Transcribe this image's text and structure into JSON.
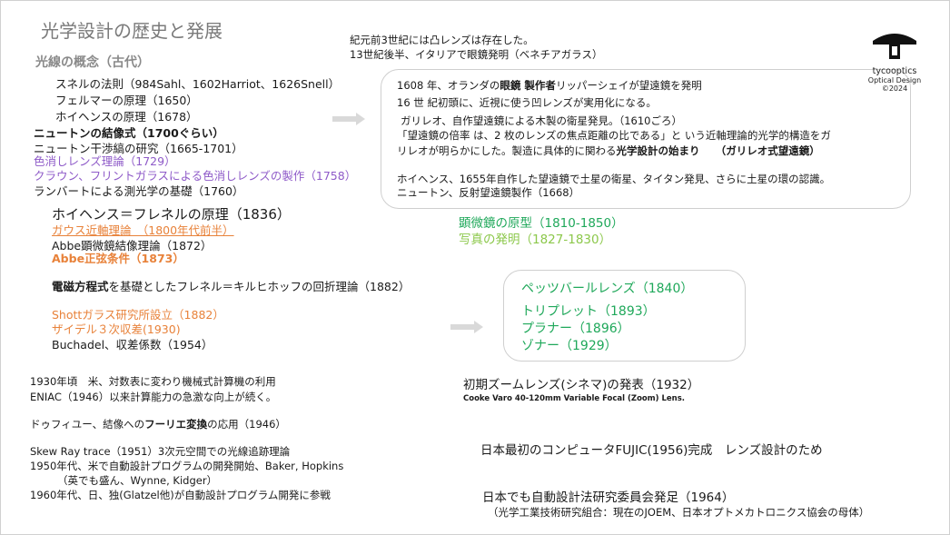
{
  "title": "光学設計の歴史と発展",
  "subtitle": "光線の概念（古代）",
  "left_list": [
    "スネルの法則（984Sahl、1602Harriot、1626Snell）",
    "フェルマーの原理（1650）",
    "ホイヘンスの原理（1678）"
  ],
  "newton_group": [
    "ニュートンの結像式（1700ぐらい）",
    "ニュートン干渉縞の研究（1665-1701）",
    "色消しレンズ理論（1729）",
    "クラウン、フリントガラスによる色消しレンズの製作（1758）",
    "ランバートによる測光学の基礎（1760）"
  ],
  "huygens_fresnel": "ホイヘンス＝フレネルの原理（1836）",
  "gauss": "ガウス近軸理論　（1800年代前半）",
  "abbe_theory": "Abbe顕微鏡結像理論（1872）",
  "abbe_sine": "Abbe正弦条件（1873）",
  "maxwell_bold": "電磁方程式",
  "maxwell_rest": "を基礎としたフレネル＝キルヒホッフの回折理論（1882）",
  "schott": "Shottガラス研究所設立（1882）",
  "seidel": "ザイデル３次収差(1930)",
  "buchadel": "Buchadel、収差係数（1954）",
  "computing": [
    "1930年頃　米、対数表に変わり機械式計算機の利用",
    "ENIAC（1946）以来計算能力の急激な向上が続く。"
  ],
  "duffieux_pre": "ドゥフィユー、結像への",
  "duffieux_bold": "フーリエ変換",
  "duffieux_post": "の応用（1946）",
  "skew": [
    "Skew Ray trace（1951）3次元空間での光線追跡理論",
    "1950年代、米で自動設計プログラムの開発開始、Baker, Hopkins",
    "（英でも盛ん、Wynne, Kidger）",
    "1960年代、日、独(Glatzel他)が自動設計プログラム開発に参戦"
  ],
  "top_center": [
    "紀元前3世紀には凸レンズは存在した。",
    "13世紀後半、イタリアで眼鏡発明（ベネチアガラス）"
  ],
  "telescope_box": {
    "l1_a": "1608 年、オランダの",
    "l1_b": "眼鏡 製作者",
    "l1_c": "リッパーシェイが望遠鏡を発明",
    "l2": "16 世 紀初頭に、近視に使う凹レンズが実用化になる。",
    "l3": "ガリレオ、自作望遠鏡による木製の衛星発見。（1610ごろ）",
    "l4": "「望遠鏡の倍率 は、2 枚のレンズの焦点距離の比である」と いう近軸理論的光学的構造をガ",
    "l5_a": "リレオが明らかにした。製造に具体的に関わる",
    "l5_b": "光学設計の始まり",
    "l5_c": "　　（ガリレオ式望遠鏡）",
    "l6": "ホイヘンス、1655年自作した望遠鏡で土星の衛星、タイタン発見、さらに土星の環の認識。",
    "l7": "ニュートン、反射望遠鏡製作（1668）"
  },
  "microscope": "顕微鏡の原型（1810-1850）",
  "photo": "写真の発明（1827-1830）",
  "lens_box": [
    "ペッツバールレンズ（1840）",
    "トリプレット（1893）",
    "プラナー（1896）",
    "ゾナー（1929）"
  ],
  "zoom_title": "初期ズームレンズ(シネマ)の発表（1932）",
  "zoom_sub": "Cooke Varo 40-120mm Variable Focal (Zoom) Lens.",
  "fujic": "日本最初のコンピュータFUJIC(1956)完成　レンズ設計のため",
  "committee": "日本でも自動設計法研究委員会発足（1964）",
  "committee_sub": "（光学工業技術研究組合：現在のJOEM、日本オプトメカトロニクス協会の母体）",
  "logo": {
    "name": "tycooptics",
    "sub": "Optical Design",
    "year": "©2024"
  },
  "colors": {
    "purple": "#8e5ac8",
    "orange": "#e8823a",
    "green": "#1fa85a",
    "light_green": "#8cc84b",
    "gray_title": "#7a7a7a"
  }
}
